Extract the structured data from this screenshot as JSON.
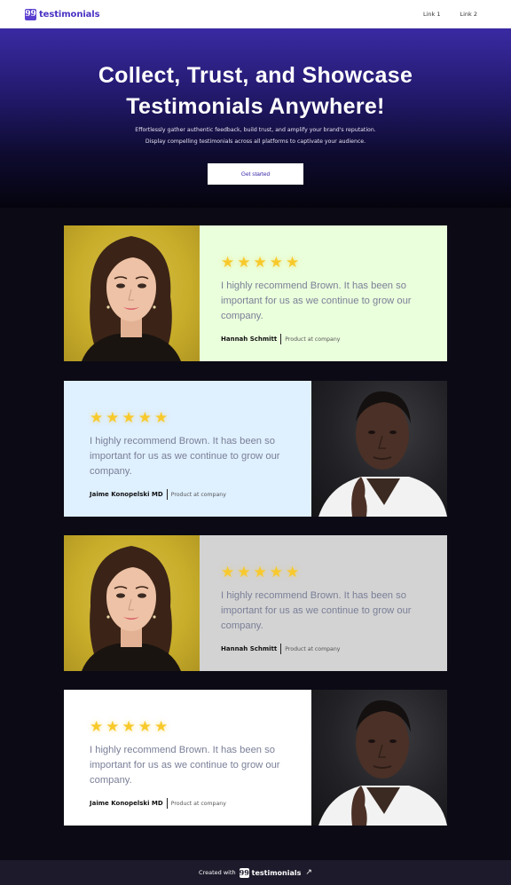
{
  "nav": {
    "logo_mark": "99",
    "logo_text": "testimonials",
    "links": [
      "Link 1",
      "Link 2"
    ]
  },
  "hero": {
    "title_line1": "Collect, Trust, and Showcase",
    "title_line2": "Testimonials Anywhere!",
    "subtitle_line1": "Effortlessly gather authentic feedback, build trust, and amplify your brand's reputation.",
    "subtitle_line2": "Display compelling testimonials across all platforms to captivate your audience.",
    "cta_label": "Get started"
  },
  "testimonials": [
    {
      "rating": 5,
      "stars": "★★★★★",
      "quote": "I highly recommend Brown. It has been so important for us as we continue to grow our company.",
      "name": "Hannah Schmitt",
      "role": "Product at company",
      "photo": "woman-portrait",
      "bg": "#eaffdc"
    },
    {
      "rating": 5,
      "stars": "★★★★★",
      "quote": "I highly recommend Brown. It has been so important for us as we continue to grow our company.",
      "name": "Jaime Konopelski MD",
      "role": "Product at company",
      "photo": "man-portrait",
      "bg": "#dff0ff"
    },
    {
      "rating": 5,
      "stars": "★★★★★",
      "quote": "I highly recommend Brown. It has been so important for us as we continue to grow our company.",
      "name": "Hannah Schmitt",
      "role": "Product at company",
      "photo": "woman-portrait",
      "bg": "#d3d3d3"
    },
    {
      "rating": 5,
      "stars": "★★★★★",
      "quote": "I highly recommend Brown. It has been so important for us as we continue to grow our company.",
      "name": "Jaime Konopelski MD",
      "role": "Product at company",
      "photo": "man-portrait",
      "bg": "#ffffff"
    }
  ],
  "footer": {
    "prefix": "Created with",
    "logo_mark": "99",
    "brand": "testimonials",
    "arrow_icon": "external-link-icon",
    "arrow": "↗"
  },
  "colors": {
    "brand": "#4a32c4",
    "star": "#f8c92b",
    "page_bg": "#0b0a15",
    "footer_bg": "#1d1b2b"
  }
}
